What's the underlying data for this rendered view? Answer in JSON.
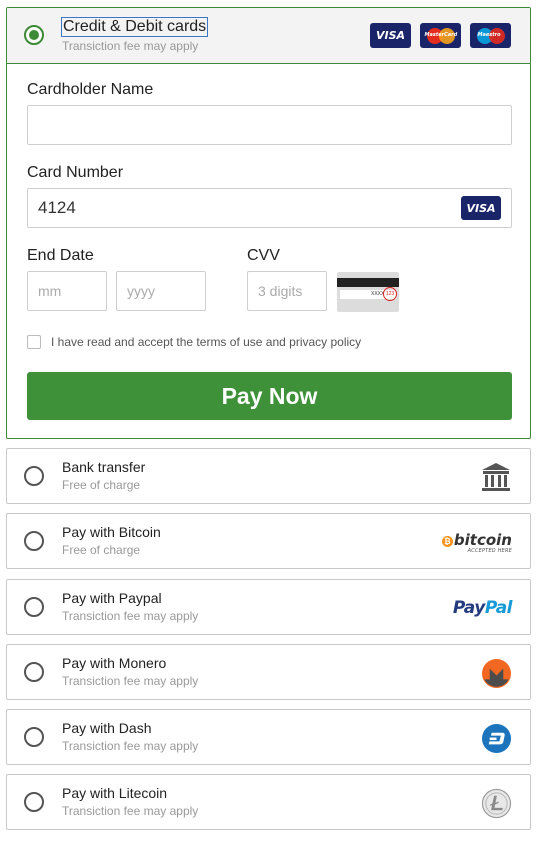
{
  "selected_method": {
    "title": "Credit & Debit cards",
    "subtitle": "Transiction fee may apply",
    "card_logos": [
      {
        "name": "visa",
        "text": "VISA"
      },
      {
        "name": "mastercard",
        "text": "MasterCard"
      },
      {
        "name": "maestro",
        "text": "Maestro"
      }
    ]
  },
  "form": {
    "cardholder_label": "Cardholder Name",
    "cardholder_value": "",
    "card_number_label": "Card Number",
    "card_number_value": "4124",
    "card_brand": "VISA",
    "end_date_label": "End Date",
    "month_placeholder": "mm",
    "year_placeholder": "yyyy",
    "cvv_label": "CVV",
    "cvv_placeholder": "3 digits",
    "cvv_image_code": "XXXX",
    "cvv_image_circle": "123",
    "terms_text": "I have read and accept the terms of use and privacy policy",
    "terms_checked": false,
    "pay_button": "Pay Now"
  },
  "methods": [
    {
      "title": "Bank transfer",
      "subtitle": "Free of charge",
      "icon": "bank-icon"
    },
    {
      "title": "Pay with Bitcoin",
      "subtitle": "Free of charge",
      "icon": "bitcoin-logo",
      "logo_text": "bitcoin",
      "logo_sub": "ACCEPTED HERE"
    },
    {
      "title": "Pay with Paypal",
      "subtitle": "Transiction fee may apply",
      "icon": "paypal-logo",
      "logo_text_1": "Pay",
      "logo_text_2": "Pal"
    },
    {
      "title": "Pay with Monero",
      "subtitle": "Transiction fee may apply",
      "icon": "monero-icon"
    },
    {
      "title": "Pay with Dash",
      "subtitle": "Transiction fee may apply",
      "icon": "dash-icon"
    },
    {
      "title": "Pay with Litecoin",
      "subtitle": "Transiction fee may apply",
      "icon": "litecoin-icon"
    }
  ],
  "colors": {
    "accent_green": "#3f9139",
    "header_bg": "#f3f3f3",
    "visa_blue": "#1a2569",
    "bitcoin_orange": "#f7931a",
    "monero_orange": "#f26822",
    "dash_blue": "#1c75bc"
  }
}
